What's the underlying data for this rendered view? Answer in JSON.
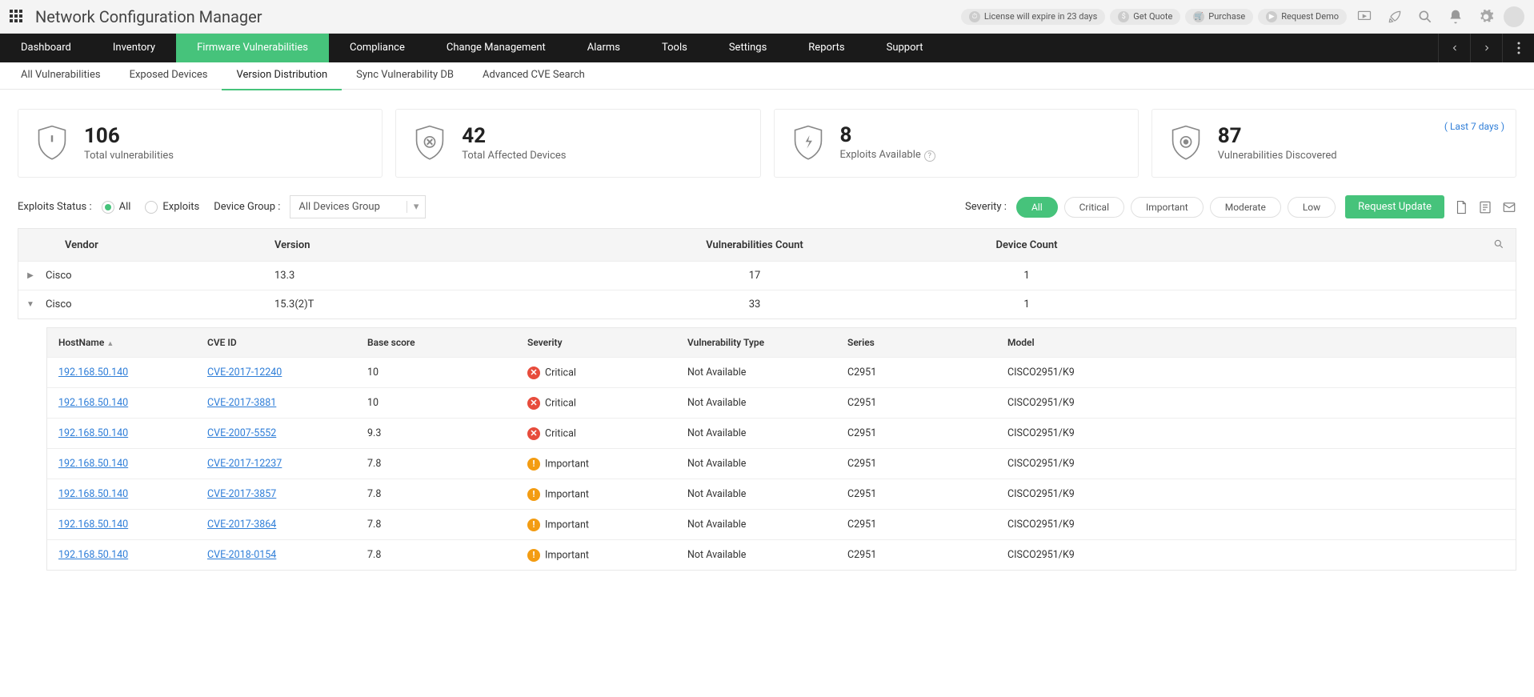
{
  "app_title": "Network Configuration Manager",
  "header_pills": {
    "license": "License will expire in 23 days",
    "quote": "Get Quote",
    "purchase": "Purchase",
    "demo": "Request Demo"
  },
  "main_nav": [
    "Dashboard",
    "Inventory",
    "Firmware Vulnerabilities",
    "Compliance",
    "Change Management",
    "Alarms",
    "Tools",
    "Settings",
    "Reports",
    "Support"
  ],
  "main_nav_active": 2,
  "sub_nav": [
    "All Vulnerabilities",
    "Exposed Devices",
    "Version Distribution",
    "Sync Vulnerability DB",
    "Advanced CVE Search"
  ],
  "sub_nav_active": 2,
  "stats": {
    "total_vuln": {
      "value": "106",
      "label": "Total vulnerabilities"
    },
    "affected": {
      "value": "42",
      "label": "Total Affected Devices"
    },
    "exploits": {
      "value": "8",
      "label": "Exploits Available"
    },
    "discovered": {
      "value": "87",
      "label": "Vulnerabilities Discovered",
      "link": "( Last 7 days )"
    }
  },
  "filters": {
    "exploits_status_label": "Exploits Status :",
    "radio_all": "All",
    "radio_exploits": "Exploits",
    "device_group_label": "Device Group :",
    "device_group_value": "All Devices Group",
    "severity_label": "Severity :",
    "severity_options": [
      "All",
      "Critical",
      "Important",
      "Moderate",
      "Low"
    ],
    "severity_active": 0,
    "request_update": "Request Update"
  },
  "main_table": {
    "headers": {
      "vendor": "Vendor",
      "version": "Version",
      "vuln": "Vulnerabilities Count",
      "device": "Device Count"
    },
    "rows": [
      {
        "expanded": false,
        "vendor": "Cisco",
        "version": "13.3",
        "vuln": "17",
        "device": "1"
      },
      {
        "expanded": true,
        "vendor": "Cisco",
        "version": "15.3(2)T",
        "vuln": "33",
        "device": "1"
      }
    ]
  },
  "detail_table": {
    "headers": {
      "host": "HostName",
      "cve": "CVE ID",
      "score": "Base score",
      "sev": "Severity",
      "type": "Vulnerability Type",
      "series": "Series",
      "model": "Model"
    },
    "rows": [
      {
        "host": "192.168.50.140",
        "cve": "CVE-2017-12240",
        "score": "10",
        "sev": "Critical",
        "type": "Not Available",
        "series": "C2951",
        "model": "CISCO2951/K9"
      },
      {
        "host": "192.168.50.140",
        "cve": "CVE-2017-3881",
        "score": "10",
        "sev": "Critical",
        "type": "Not Available",
        "series": "C2951",
        "model": "CISCO2951/K9"
      },
      {
        "host": "192.168.50.140",
        "cve": "CVE-2007-5552",
        "score": "9.3",
        "sev": "Critical",
        "type": "Not Available",
        "series": "C2951",
        "model": "CISCO2951/K9"
      },
      {
        "host": "192.168.50.140",
        "cve": "CVE-2017-12237",
        "score": "7.8",
        "sev": "Important",
        "type": "Not Available",
        "series": "C2951",
        "model": "CISCO2951/K9"
      },
      {
        "host": "192.168.50.140",
        "cve": "CVE-2017-3857",
        "score": "7.8",
        "sev": "Important",
        "type": "Not Available",
        "series": "C2951",
        "model": "CISCO2951/K9"
      },
      {
        "host": "192.168.50.140",
        "cve": "CVE-2017-3864",
        "score": "7.8",
        "sev": "Important",
        "type": "Not Available",
        "series": "C2951",
        "model": "CISCO2951/K9"
      },
      {
        "host": "192.168.50.140",
        "cve": "CVE-2018-0154",
        "score": "7.8",
        "sev": "Important",
        "type": "Not Available",
        "series": "C2951",
        "model": "CISCO2951/K9"
      }
    ]
  }
}
